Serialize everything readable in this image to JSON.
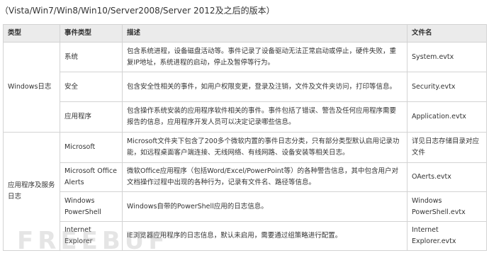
{
  "intro": "（Vista/Win7/Win8/Win10/Server2008/Server 2012及之后的版本）",
  "table": {
    "headers": [
      "类型",
      "事件类型",
      "描述",
      "文件名"
    ],
    "groups": [
      "Windows日志",
      "应用程序及服务日志"
    ],
    "rows": [
      {
        "event_type": "系统",
        "description": "包含系统进程，设备磁盘活动等。事件记录了设备驱动无法正常启动或停止，硬件失败，重复IP地址，系统进程的启动，停止及暂停等行为。",
        "file": "System.evtx"
      },
      {
        "event_type": "安全",
        "description": "包含安全性相关的事件，如用户权限变更，登录及注销，文件及文件夹访问，打印等信息。",
        "file": "Security.evtx"
      },
      {
        "event_type": "应用程序",
        "description": "包含操作系统安装的应用程序软件相关的事件。事件包括了错误、警告及任何应用程序需要报告的信息，应用程序开发人员可以决定记录哪些信息。",
        "file": "Application.evtx"
      },
      {
        "event_type": "Microsoft",
        "description": "Microsoft文件夹下包含了200多个微软内置的事件日志分类，只有部分类型默认启用记录功能，如远程桌面客户端连接、无线网络、有线网路、设备安装等相关日志。",
        "file": "详见日志存储目录对应文件"
      },
      {
        "event_type": "Microsoft Office Alerts",
        "description": "微软Office应用程序（包括Word/Excel/PowerPoint等）的各种警告信息，其中包含用户对文档操作过程中出现的各种行为，记录有文件名、路径等信息。",
        "file": "OAerts.evtx"
      },
      {
        "event_type": "Windows PowerShell",
        "description": "Windows自带的PowerShell应用的日志信息。",
        "file": "Windows PowerShell.evtx"
      },
      {
        "event_type": "Internet Explorer",
        "description": "IE浏览器应用程序的日志信息，默认未启用，需要通过组策略进行配置。",
        "file": "Internet Explorer.evtx"
      }
    ]
  },
  "watermark": "FREEBUF"
}
